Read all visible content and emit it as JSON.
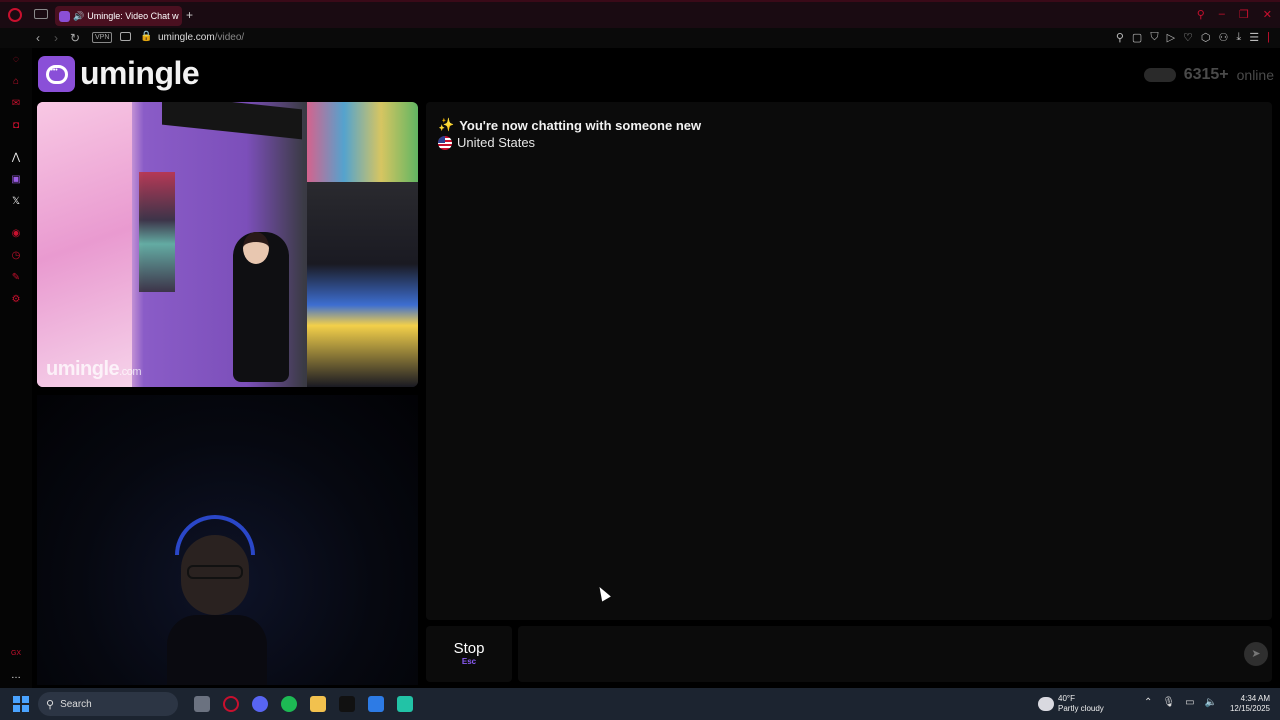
{
  "browser": {
    "tab_title": "Umingle: Video Chat w",
    "url_host": "umingle.com",
    "url_path": "/video/",
    "vpn_label": "VPN"
  },
  "site": {
    "logo_text": "umingle",
    "online_count": "6315+",
    "online_label": "online",
    "accent_color": "#8a4fd8"
  },
  "remote_video": {
    "watermark": "umingle",
    "watermark_domain": ".com"
  },
  "chat": {
    "message": "You're now chatting with someone new",
    "country": "United States"
  },
  "controls": {
    "stop_label": "Stop",
    "stop_key": "Esc"
  },
  "taskbar": {
    "search_label": "Search",
    "weather_temp": "40°F",
    "weather_desc": "Partly cloudy",
    "time": "4:34 AM",
    "date": "12/15/2025"
  }
}
